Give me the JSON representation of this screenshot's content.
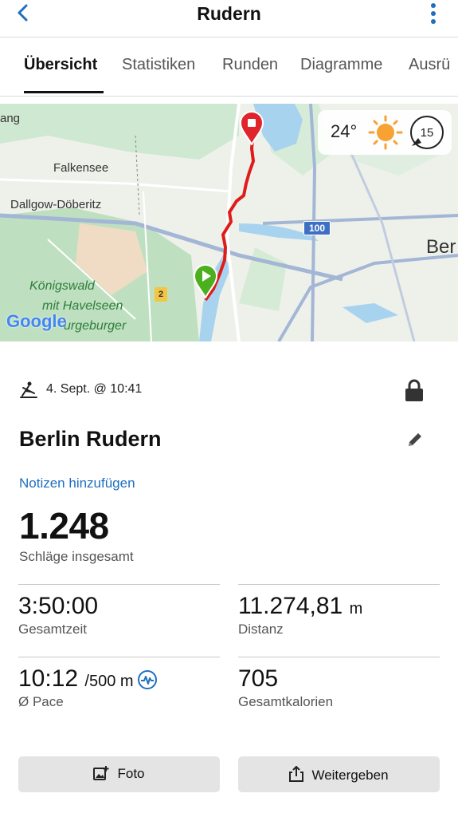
{
  "header": {
    "title": "Rudern",
    "back_icon": "chevron-left-icon",
    "more_icon": "more-vertical-icon"
  },
  "tabs": [
    {
      "label": "Übersicht",
      "active": true
    },
    {
      "label": "Statistiken"
    },
    {
      "label": "Runden"
    },
    {
      "label": "Diagramme"
    },
    {
      "label": "Ausrü"
    }
  ],
  "map": {
    "places": [
      "ang",
      "Falkensee",
      "Dallgow-Döberitz",
      "Königswald",
      "mit Havelseen",
      "urgeburger",
      "Ber"
    ],
    "road_badges": [
      "100",
      "2"
    ],
    "logo": "Google",
    "route_color": "#e01b1b",
    "start_marker_color": "#4caf1d",
    "end_marker_color": "#e0242b"
  },
  "weather": {
    "temperature": "24°",
    "wind": "15"
  },
  "activity": {
    "type_icon": "rowing-icon",
    "datetime": "4. Sept. @ 10:41",
    "title": "Berlin Rudern",
    "notes_link": "Notizen hinzufügen",
    "strokes_value": "1.248",
    "strokes_label": "Schläge insgesamt"
  },
  "stats": [
    {
      "value": "3:50:00",
      "unit": "",
      "label": "Gesamtzeit"
    },
    {
      "value": "11.274,81",
      "unit": "m",
      "label": "Distanz"
    },
    {
      "value": "10:12",
      "unit": "/500 m",
      "label": "Ø Pace"
    },
    {
      "value": "705",
      "unit": "",
      "label": "Gesamtkalorien"
    }
  ],
  "buttons": {
    "photo": "Foto",
    "share": "Weitergeben"
  },
  "colors": {
    "accent": "#1f6fbf",
    "button_bg": "#e4e4e4"
  }
}
